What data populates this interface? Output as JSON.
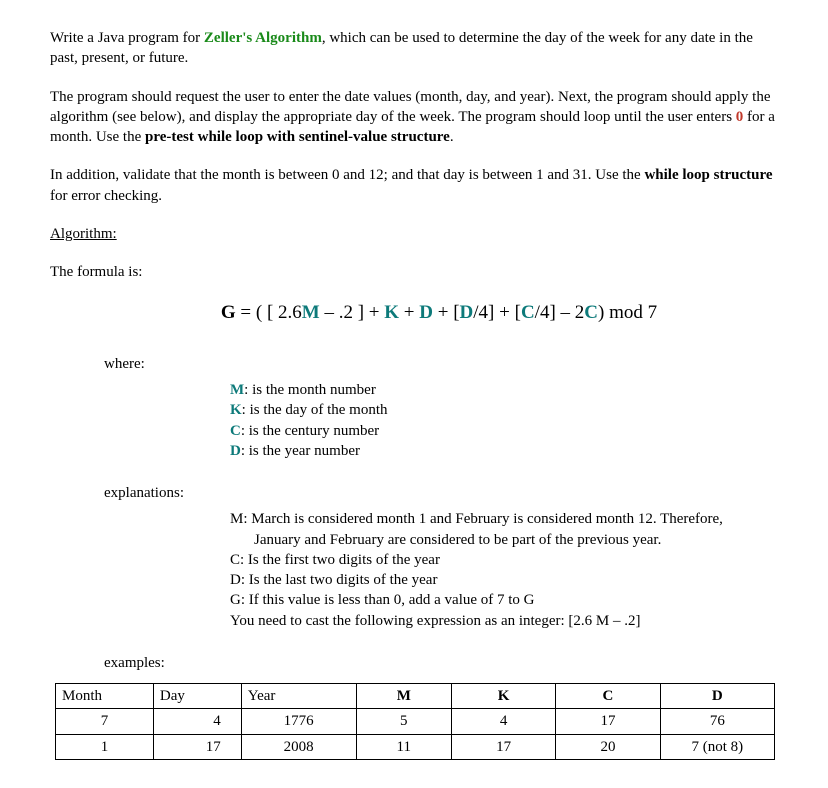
{
  "p1_a": "Write a Java program for ",
  "p1_b": "Zeller's Algorithm",
  "p1_c": ", which can be used to determine the day of the week for any date in the past, present, or future.",
  "p2_a": "The program should request the user to enter the date values (month, day, and year). Next, the program should apply the algorithm (see below), and display the appropriate day of the week. The program should loop until the user enters ",
  "p2_b": "0",
  "p2_c": " for a month. Use the ",
  "p2_d": "pre-test while loop with sentinel-value structure",
  "p2_e": ".",
  "p3_a": "In addition, validate that the month is between 0 and 12; and that day is between 1 and 31. Use the ",
  "p3_b": "while loop structure",
  "p3_c": " for error checking.",
  "alg_label": "Algorithm:",
  "formula_label": "The formula is:",
  "formula": {
    "lhs": "G",
    "eq": " = ( [ ",
    "t1": "2.6",
    "v1": "M",
    "t2": " – .2 ] + ",
    "v2": "K",
    "t3": " + ",
    "v3": "D",
    "t4": " + [",
    "v3b": "D",
    "t5": "/4] + [",
    "v4": "C",
    "t6": "/4] – 2",
    "v4b": "C",
    "t7": ") mod 7"
  },
  "where_label": "where:",
  "defs": {
    "m": "M",
    "m_t": ": is the month number",
    "k": "K",
    "k_t": ": is the day of the month",
    "c": "C",
    "c_t": ": is the century number",
    "d": "D",
    "d_t": ": is the year number"
  },
  "expl_label": "explanations:",
  "expl": {
    "l1": "M: March is considered month 1 and February is considered month 12. Therefore,",
    "l1b": "January and February are considered to be part of the previous year.",
    "l2": "C: Is the first two digits of the year",
    "l3": "D: Is the last two digits of the year",
    "l4": "G: If this value is less than 0, add a value of 7 to G",
    "l5": "You need to cast the following expression as an integer: [2.6 M – .2]"
  },
  "examples_label": "examples:",
  "table": {
    "headers": [
      "Month",
      "Day",
      "Year",
      "M",
      "K",
      "C",
      "D"
    ],
    "rows": [
      [
        "7",
        "4",
        "1776",
        "5",
        "4",
        "17",
        "76"
      ],
      [
        "1",
        "17",
        "2008",
        "11",
        "17",
        "20",
        "7 (not 8)"
      ]
    ]
  },
  "chart_data": {
    "type": "table",
    "title": "Zeller's Algorithm examples",
    "columns": [
      "Month",
      "Day",
      "Year",
      "M",
      "K",
      "C",
      "D"
    ],
    "rows": [
      {
        "Month": 7,
        "Day": 4,
        "Year": 1776,
        "M": 5,
        "K": 4,
        "C": 17,
        "D": "76"
      },
      {
        "Month": 1,
        "Day": 17,
        "Year": 2008,
        "M": 11,
        "K": 17,
        "C": 20,
        "D": "7 (not 8)"
      }
    ]
  }
}
